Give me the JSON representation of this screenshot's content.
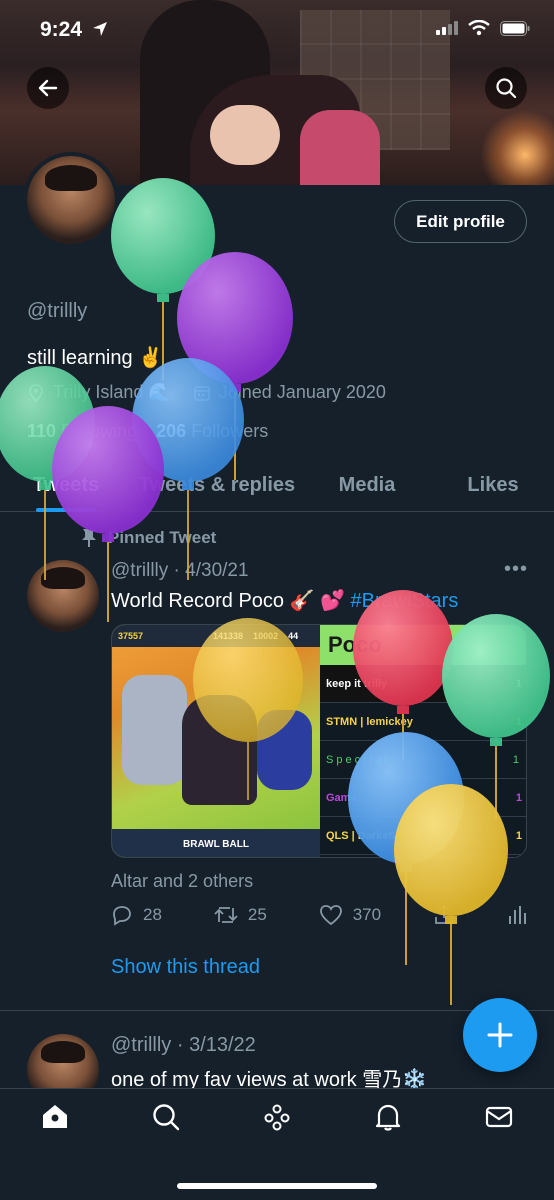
{
  "status": {
    "time": "9:24"
  },
  "profile": {
    "edit_label": "Edit profile",
    "handle": "@trillly",
    "bio": "still learning ✌️",
    "location": "Trilly Island 🌊",
    "joined": "Joined January 2020",
    "following_count": "110",
    "following_label": "Following",
    "followers_count": "206",
    "followers_label": "Followers"
  },
  "tabs": [
    {
      "label": "Tweets"
    },
    {
      "label": "Tweets & replies"
    },
    {
      "label": "Media"
    },
    {
      "label": "Likes"
    }
  ],
  "pinned_tweet": {
    "pinned_label": "Pinned Tweet",
    "header": "@trillly · 4/30/21",
    "text": "World Record Poco 🎸 💕 ",
    "hashtag": "#BrawlStars",
    "media": {
      "hud_values": [
        "37557",
        "141338",
        "10002",
        "44"
      ],
      "game_button": "BRAWL BALL",
      "board_title": "Poco",
      "board_rows": [
        {
          "name": "keep it trilly",
          "value": "1"
        },
        {
          "name": "STMN | lemickey",
          "value": "1"
        },
        {
          "name": "Spectral",
          "value": "1"
        },
        {
          "name": "Gama",
          "value": "1"
        },
        {
          "name": "QLS | DarkeS",
          "value": "1"
        }
      ]
    },
    "liked_by": "Altar and 2 others",
    "replies": "28",
    "retweets": "25",
    "likes": "370",
    "show_thread": "Show this thread"
  },
  "second_tweet": {
    "header": "@trillly · 3/13/22",
    "text": "one of my fav views at work 雪乃❄️"
  },
  "colors": {
    "background": "#15202b",
    "accent": "#1d9bf0",
    "muted": "#8899a6",
    "border": "#38444d"
  },
  "icons": [
    "back-arrow-icon",
    "search-icon",
    "location-icon",
    "calendar-icon",
    "pin-icon",
    "more-icon",
    "reply-icon",
    "retweet-icon",
    "like-icon",
    "share-icon",
    "analytics-icon",
    "compose-icon",
    "home-icon",
    "explore-icon",
    "spaces-icon",
    "notifications-icon",
    "messages-icon"
  ]
}
